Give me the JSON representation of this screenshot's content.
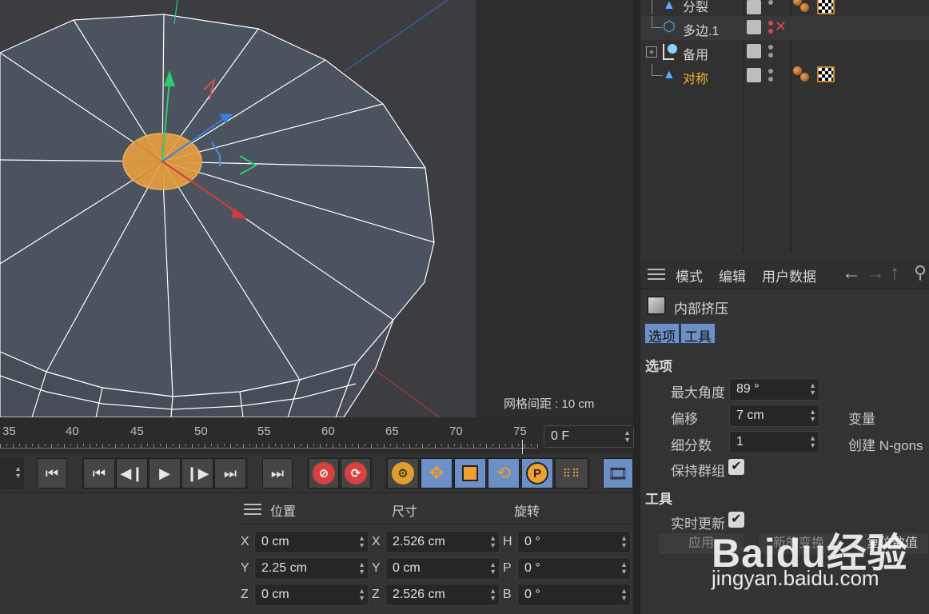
{
  "viewport": {
    "grid_spacing_label": "网格间距 : 10 cm"
  },
  "timeline": {
    "ticks": [
      "35",
      "40",
      "45",
      "50",
      "55",
      "60",
      "65",
      "70",
      "75"
    ],
    "frame_value": "0 F"
  },
  "coordinates": {
    "headers": {
      "position": "位置",
      "size": "尺寸",
      "rotation": "旋转"
    },
    "rows": [
      {
        "pos_axis": "X",
        "pos": "0 cm",
        "size_axis": "X",
        "size": "2.526 cm",
        "rot_axis": "H",
        "rot": "0 °"
      },
      {
        "pos_axis": "Y",
        "pos": "2.25 cm",
        "size_axis": "Y",
        "size": "0 cm",
        "rot_axis": "P",
        "rot": "0 °"
      },
      {
        "pos_axis": "Z",
        "pos": "0 cm",
        "size_axis": "Z",
        "size": "2.526 cm",
        "rot_axis": "B",
        "rot": "0 °"
      }
    ]
  },
  "object_manager": {
    "objects": [
      {
        "name": "分裂",
        "icon": "triangle-icon"
      },
      {
        "name": "多边.1",
        "icon": "polygon-icon"
      },
      {
        "name": "备用",
        "icon": "light-icon"
      },
      {
        "name": "对称",
        "icon": "triangle-icon"
      }
    ]
  },
  "attributes": {
    "menu": {
      "mode": "模式",
      "edit": "编辑",
      "user_data": "用户数据"
    },
    "tool_name": "内部挤压",
    "tabs": {
      "options": "选项",
      "tool": "工具"
    },
    "options_section": "选项",
    "max_angle_label": "最大角度",
    "max_angle_value": "89 °",
    "offset_label": "偏移",
    "offset_value": "7 cm",
    "variance_label": "变量",
    "subdivision_label": "细分数",
    "subdivision_value": "1",
    "create_ngons_label": "创建 N-gons",
    "preserve_groups_label": "保持群组",
    "tool_section": "工具",
    "realtime_update_label": "实时更新",
    "apply_button": "应用",
    "new_transform_button": "新的变换",
    "reset_button": "复位数值"
  },
  "watermark": {
    "logo": "Baidu经验",
    "url": "jingyan.baidu.com"
  },
  "colors": {
    "accent_blue": "#6d90c7",
    "selection_orange": "#f2a23a",
    "highlight_text": "#f2b234"
  }
}
